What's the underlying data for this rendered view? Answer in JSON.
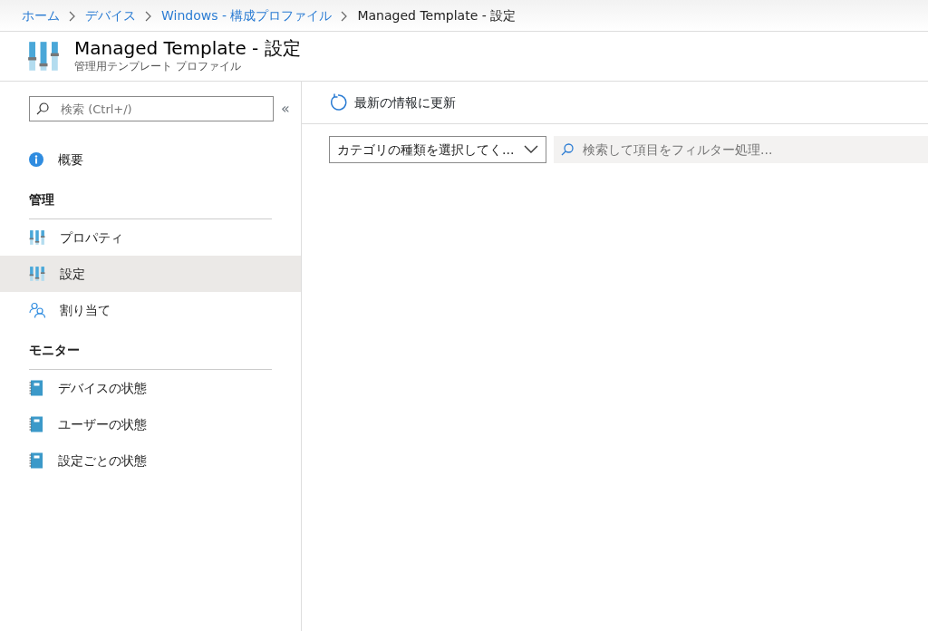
{
  "breadcrumb": [
    {
      "label": "ホーム",
      "link": true
    },
    {
      "label": "デバイス",
      "link": true
    },
    {
      "label": "Windows - 構成プロファイル",
      "link": true
    },
    {
      "label": "Managed Template - 設定",
      "link": false
    }
  ],
  "header": {
    "title": "Managed Template - 設定",
    "subtitle": "管理用テンプレート プロファイル"
  },
  "sidebar": {
    "search": {
      "placeholder": "検索 (Ctrl+/)"
    },
    "collapse": "«",
    "top_items": [
      {
        "label": "概要",
        "kind": "info",
        "selected": false
      }
    ],
    "groups": [
      {
        "heading": "管理",
        "items": [
          {
            "label": "プロパティ",
            "kind": "sliders",
            "selected": false
          },
          {
            "label": "設定",
            "kind": "sliders",
            "selected": true
          },
          {
            "label": "割り当て",
            "kind": "people",
            "selected": false
          }
        ]
      },
      {
        "heading": "モニター",
        "items": [
          {
            "label": "デバイスの状態",
            "kind": "book",
            "selected": false
          },
          {
            "label": "ユーザーの状態",
            "kind": "book",
            "selected": false
          },
          {
            "label": "設定ごとの状態",
            "kind": "book",
            "selected": false
          }
        ]
      }
    ]
  },
  "toolbar": {
    "refresh": "最新の情報に更新"
  },
  "filters": {
    "category": {
      "value": "カテゴリの種類を選択してく..."
    },
    "search": {
      "placeholder": "検索して項目をフィルター処理..."
    }
  }
}
